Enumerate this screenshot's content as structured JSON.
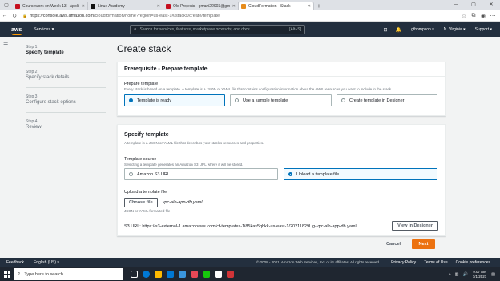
{
  "browser": {
    "tabs": [
      {
        "label": "Coursework on Week 13 - Appli",
        "color": "#c50f1f",
        "active": false
      },
      {
        "label": "Linux Academy",
        "color": "#111111",
        "active": false
      },
      {
        "label": "Old Projects - gmani22903@gm",
        "color": "#c50f1f",
        "active": false
      },
      {
        "label": "CloudFormation - Stack",
        "color": "#e78c1b",
        "active": true
      }
    ],
    "new_tab": "+",
    "url_host": "https://console.aws.amazon.com",
    "url_path": "/cloudformation/home?region=us-east-1#/stacks/create/template"
  },
  "aws_nav": {
    "logo": "aws",
    "services": "Services ▾",
    "search_placeholder": "Search for services, features, marketplace products, and docs",
    "search_shortcut": "[Alt+S]",
    "user": "gthompson ▾",
    "region": "N. Virginia ▾",
    "support": "Support ▾"
  },
  "sidebar": {
    "steps": [
      {
        "number": "Step 1",
        "title": "Specify template",
        "active": true
      },
      {
        "number": "Step 2",
        "title": "Specify stack details",
        "active": false
      },
      {
        "number": "Step 3",
        "title": "Configure stack options",
        "active": false
      },
      {
        "number": "Step 4",
        "title": "Review",
        "active": false
      }
    ]
  },
  "main": {
    "title": "Create stack",
    "prereq": {
      "header": "Prerequisite - Prepare template",
      "label": "Prepare template",
      "desc": "Every stack is based on a template. A template is a JSON or YAML file that contains configuration information about the AWS resources you want to include in the stack.",
      "options": [
        "Template is ready",
        "Use a sample template",
        "Create template in Designer"
      ],
      "selected": 0
    },
    "specify": {
      "header": "Specify template",
      "desc": "A template is a JSON or YAML file that describes your stack's resources and properties.",
      "source_label": "Template source",
      "source_desc": "Selecting a template generates an Amazon S3 URL where it will be stored.",
      "options": [
        "Amazon S3 URL",
        "Upload a template file"
      ],
      "selected": 1,
      "upload_label": "Upload a template file",
      "choose_file": "Choose file",
      "file_name": "vpc-alb-app-db.yaml",
      "format_hint": "JSON or YAML formatted file",
      "s3_label": "S3 URL:",
      "s3_url": "https://s3-external-1.amazonaws.com/cf-templates-1i85kas5qhkk-us-east-1/20211829Ug-vpc-alb-app-db.yaml",
      "view_designer": "View in Designer"
    },
    "cancel": "Cancel",
    "next": "Next"
  },
  "footer": {
    "feedback": "Feedback",
    "language": "English (US) ▾",
    "copyright": "© 2008 - 2021, Amazon Web Services, Inc. or its affiliates. All rights reserved.",
    "links": [
      "Privacy Policy",
      "Terms of Use",
      "Cookie preferences"
    ]
  },
  "taskbar": {
    "search_placeholder": "Type here to search",
    "time": "9:07 AM",
    "date": "7/1/2021",
    "icon_colors": [
      "#ffffff",
      "#0078d4",
      "#ffb900",
      "#0078d4",
      "#3a96dd",
      "#e74856",
      "#16c60c",
      "#ffffff",
      "#d13438"
    ]
  }
}
